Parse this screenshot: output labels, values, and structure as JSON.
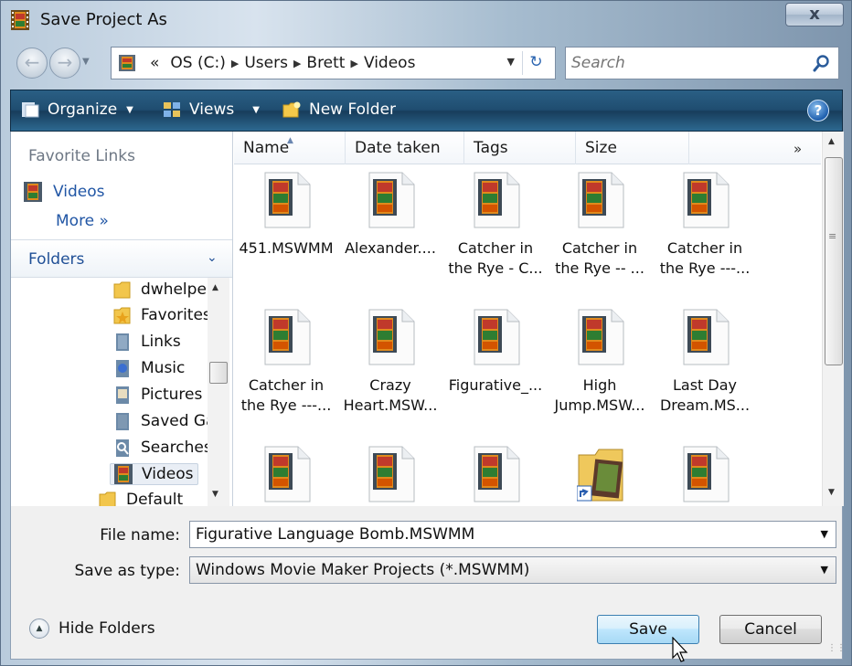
{
  "window": {
    "title": "Save Project As",
    "close_label": "x"
  },
  "nav": {
    "breadcrumb": [
      "«",
      "OS (C:)",
      "Users",
      "Brett",
      "Videos"
    ],
    "search_placeholder": "Search"
  },
  "toolbar": {
    "organize": "Organize",
    "views": "Views",
    "new_folder": "New Folder",
    "help": "?"
  },
  "sidebar": {
    "favorite_links_header": "Favorite Links",
    "favorite_videos": "Videos",
    "more": "More »",
    "folders_header": "Folders",
    "tree": [
      "dwhelpe",
      "Favorites",
      "Links",
      "Music",
      "Pictures",
      "Saved Ga",
      "Searches",
      "Videos",
      "Default"
    ]
  },
  "columns": [
    "Name",
    "Date taken",
    "Tags",
    "Size"
  ],
  "col_more": "»",
  "files": [
    {
      "line1": "451.MSWMM",
      "line2": ""
    },
    {
      "line1": "Alexander....",
      "line2": ""
    },
    {
      "line1": "Catcher in",
      "line2": "the Rye - C..."
    },
    {
      "line1": "Catcher in",
      "line2": "the Rye -- ..."
    },
    {
      "line1": "Catcher in",
      "line2": "the Rye ---..."
    },
    {
      "line1": "Catcher in",
      "line2": "the Rye ---..."
    },
    {
      "line1": "Crazy",
      "line2": "Heart.MSW..."
    },
    {
      "line1": "Figurative_...",
      "line2": ""
    },
    {
      "line1": "High",
      "line2": "Jump.MSW..."
    },
    {
      "line1": "Last Day",
      "line2": "Dream.MS..."
    }
  ],
  "form": {
    "file_name_label": "File name:",
    "file_name_value": "Figurative Language Bomb.MSWMM",
    "save_type_label": "Save as type:",
    "save_type_value": "Windows Movie Maker Projects (*.MSWMM)"
  },
  "actions": {
    "hide_folders": "Hide Folders",
    "save": "Save",
    "cancel": "Cancel"
  },
  "colors": {
    "toolbar": "#1f4d70",
    "link": "#2156a5",
    "save_button": "#bee6fd"
  }
}
